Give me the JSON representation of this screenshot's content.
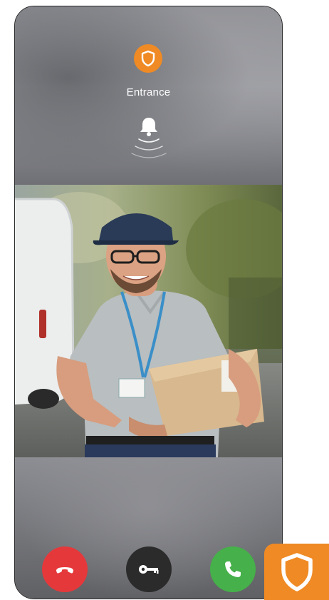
{
  "app": {
    "title": "Entrance"
  },
  "icons": {
    "header_badge": "shield-icon",
    "doorbell": "bell-ringing-icon",
    "decline": "phone-hangup-icon",
    "unlock": "key-icon",
    "accept": "phone-icon",
    "brand": "shield-logo-icon"
  },
  "colors": {
    "accent_orange": "#ef8a24",
    "decline_red": "#e5383b",
    "unlock_dark": "#2b2b2b",
    "accept_green": "#46b04a"
  }
}
